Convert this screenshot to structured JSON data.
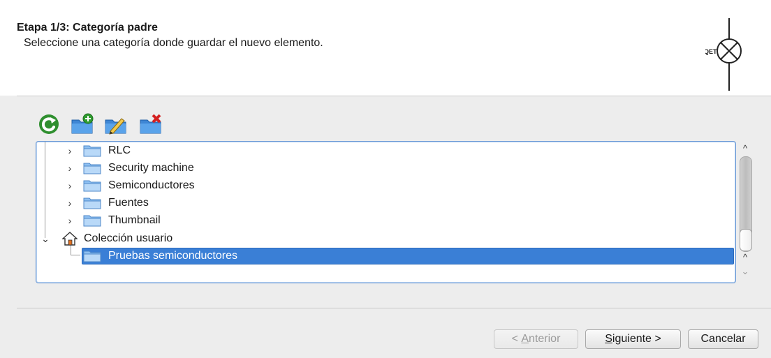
{
  "header": {
    "title": "Etapa 1/3: Categoría padre",
    "subtitle": "Seleccione una categoría donde guardar el nuevo elemento.",
    "logo_text": "QET"
  },
  "toolbar": {
    "buttons": [
      {
        "icon": "reload-icon"
      },
      {
        "icon": "new-folder-icon"
      },
      {
        "icon": "edit-folder-icon"
      },
      {
        "icon": "delete-folder-icon"
      }
    ]
  },
  "tree": {
    "items": [
      {
        "label": "RLC",
        "expander": "›",
        "icon": "folder-icon"
      },
      {
        "label": "Security machine",
        "expander": "›",
        "icon": "folder-icon"
      },
      {
        "label": "Semiconductores",
        "expander": "›",
        "icon": "folder-icon"
      },
      {
        "label": "Fuentes",
        "expander": "›",
        "icon": "folder-icon"
      },
      {
        "label": "Thumbnail",
        "expander": "›",
        "icon": "folder-icon"
      },
      {
        "label": "Colección usuario",
        "expander": "⌄",
        "icon": "home-icon"
      },
      {
        "label": "Pruebas semiconductores",
        "icon": "folder-icon",
        "selected": true
      }
    ]
  },
  "scrollbar": {
    "up_arrow": "^",
    "down_arrow_1": "^",
    "down_arrow_2": "⌄"
  },
  "buttons": {
    "back_prefix": "< ",
    "back_mnemonic": "A",
    "back_rest": "nterior",
    "next_mnemonic": "S",
    "next_rest": "iguiente >",
    "cancel": "Cancelar"
  },
  "colors": {
    "selection": "#3a7fd6",
    "tree_border": "#6c9ad6"
  }
}
